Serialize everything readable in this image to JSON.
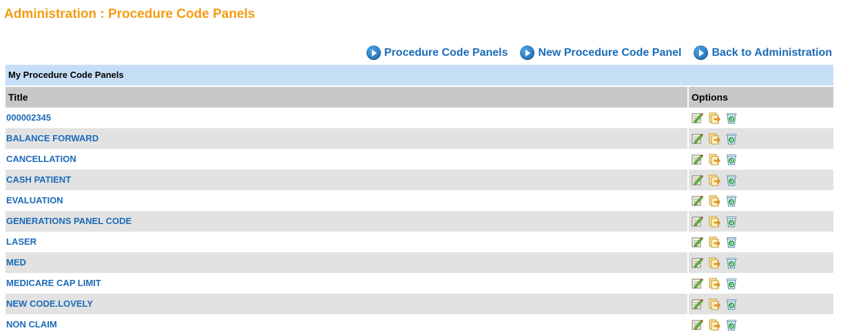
{
  "page": {
    "title": "Administration : Procedure Code Panels"
  },
  "nav": {
    "links": [
      {
        "label": "Procedure Code Panels",
        "icon": "arrow-right-circle-icon"
      },
      {
        "label": "New Procedure Code Panel",
        "icon": "arrow-right-circle-icon"
      },
      {
        "label": "Back to Administration",
        "icon": "arrow-right-circle-icon"
      }
    ]
  },
  "panel": {
    "header": "My Procedure Code Panels",
    "columns": {
      "title": "Title",
      "options": "Options"
    },
    "rows": [
      {
        "title": "000002345"
      },
      {
        "title": "BALANCE FORWARD"
      },
      {
        "title": "CANCELLATION"
      },
      {
        "title": "CASH PATIENT"
      },
      {
        "title": "EVALUATION"
      },
      {
        "title": "GENERATIONS PANEL CODE"
      },
      {
        "title": "LASER"
      },
      {
        "title": "MED"
      },
      {
        "title": "MEDICARE CAP LIMIT"
      },
      {
        "title": "NEW CODE.LOVELY"
      },
      {
        "title": "NON CLAIM"
      }
    ],
    "row_option_icons": [
      "edit-icon",
      "copy-icon",
      "delete-icon"
    ]
  },
  "colors": {
    "title": "#f39c12",
    "link": "#1a6bb8",
    "panel_header_bg": "#c6dff7",
    "column_header_bg": "#c8c8c8",
    "alt_row_bg": "#e2e2e2"
  }
}
